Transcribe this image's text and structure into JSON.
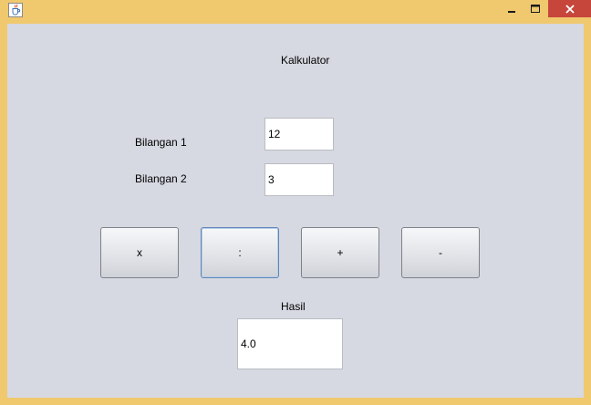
{
  "window": {
    "app_icon": "java-icon",
    "controls": {
      "minimize": "minimize-icon",
      "maximize": "maximize-icon",
      "close": "close-icon"
    },
    "colors": {
      "frame": "#f0c86e",
      "client": "#d6d9e1",
      "close_button": "#c7463b"
    }
  },
  "form": {
    "title": "Kalkulator",
    "bilangan1_label": "Bilangan 1",
    "bilangan1_value": "12",
    "bilangan2_label": "Bilangan 2",
    "bilangan2_value": "3",
    "buttons": {
      "multiply": "x",
      "divide": ":",
      "add": "+",
      "subtract": "-"
    },
    "focused_button": "divide",
    "hasil_label": "Hasil",
    "hasil_value": "4.0"
  }
}
